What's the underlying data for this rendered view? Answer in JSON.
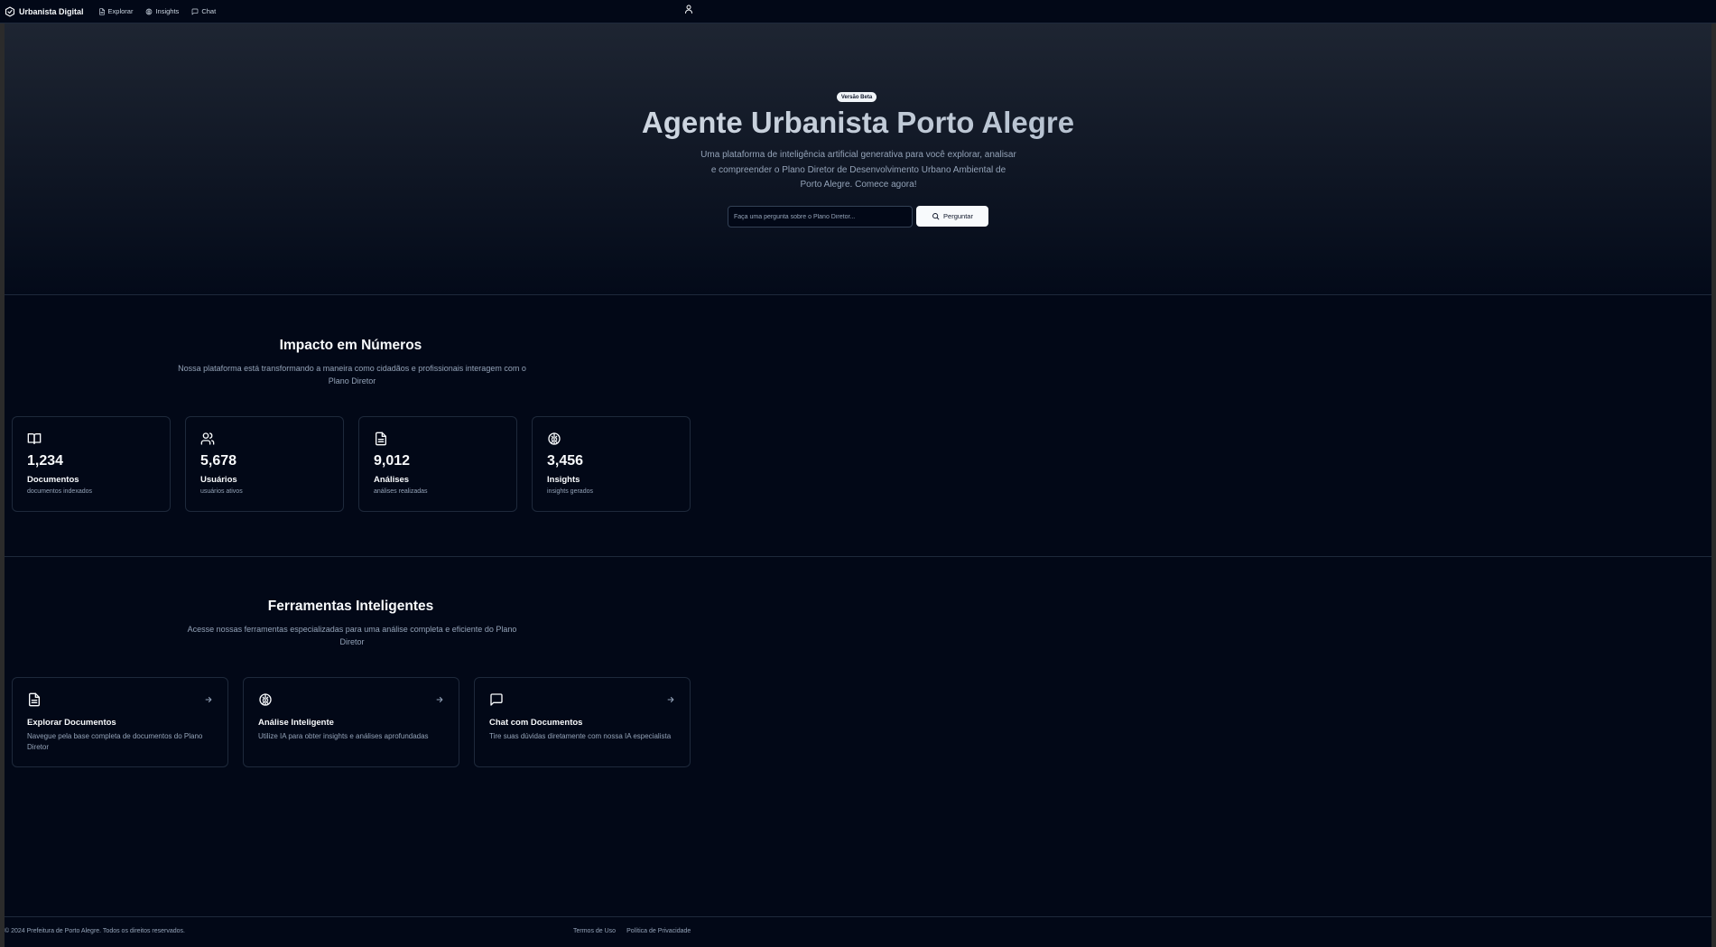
{
  "header": {
    "brand": "Urbanista Digital",
    "nav": [
      {
        "label": "Explorar",
        "icon": "file-icon"
      },
      {
        "label": "Insights",
        "icon": "brain-icon"
      },
      {
        "label": "Chat",
        "icon": "message-icon"
      }
    ]
  },
  "hero": {
    "badge": "Versão Beta",
    "title": "Agente Urbanista Porto Alegre",
    "subtitle": "Uma plataforma de inteligência artificial generativa para você explorar, analisar e compreender o Plano Diretor de Desenvolvimento Urbano Ambiental de Porto Alegre. Comece agora!",
    "search_placeholder": "Faça uma pergunta sobre o Plano Diretor...",
    "button_label": "Perguntar"
  },
  "impact": {
    "title": "Impacto em Números",
    "subtitle": "Nossa plataforma está transformando a maneira como cidadãos e profissionais interagem com o Plano Diretor",
    "stats": [
      {
        "value": "1,234",
        "label": "Documentos",
        "desc": "documentos indexados",
        "icon": "book-icon"
      },
      {
        "value": "5,678",
        "label": "Usuários",
        "desc": "usuários ativos",
        "icon": "users-icon"
      },
      {
        "value": "9,012",
        "label": "Análises",
        "desc": "análises realizadas",
        "icon": "file-icon"
      },
      {
        "value": "3,456",
        "label": "Insights",
        "desc": "insights gerados",
        "icon": "brain-icon"
      }
    ]
  },
  "tools": {
    "title": "Ferramentas Inteligentes",
    "subtitle": "Acesse nossas ferramentas especializadas para uma análise completa e eficiente do Plano Diretor",
    "items": [
      {
        "title": "Explorar Documentos",
        "desc": "Navegue pela base completa de documentos do Plano Diretor",
        "icon": "file-icon"
      },
      {
        "title": "Análise Inteligente",
        "desc": "Utilize IA para obter insights e análises aprofundadas",
        "icon": "brain-icon"
      },
      {
        "title": "Chat com Documentos",
        "desc": "Tire suas dúvidas diretamente com nossa IA especialista",
        "icon": "message-icon"
      }
    ]
  },
  "footer": {
    "copyright": "© 2024 Prefeitura de Porto Alegre. Todos os direitos reservados.",
    "links": [
      "Termos de Uso",
      "Política de Privacidade"
    ]
  }
}
